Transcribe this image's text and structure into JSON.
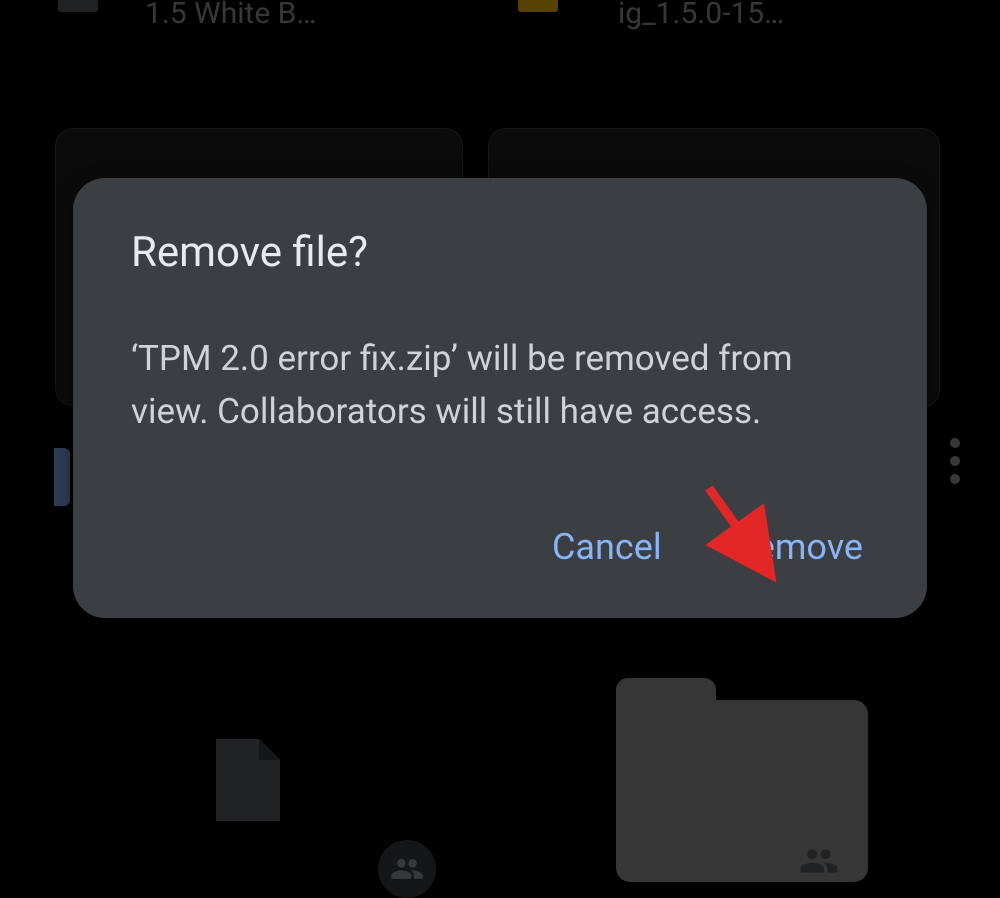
{
  "background": {
    "file_labels": [
      "1.5 White B…",
      "ig_1.5.0-15…"
    ]
  },
  "dialog": {
    "title": "Remove file?",
    "message": "‘TPM 2.0 error fix.zip’ will be removed from view. Collaborators will still have access.",
    "cancel_label": "Cancel",
    "confirm_label": "Remove"
  },
  "annotation": {
    "arrow_color": "#e32626",
    "arrow_target": "remove-button"
  }
}
